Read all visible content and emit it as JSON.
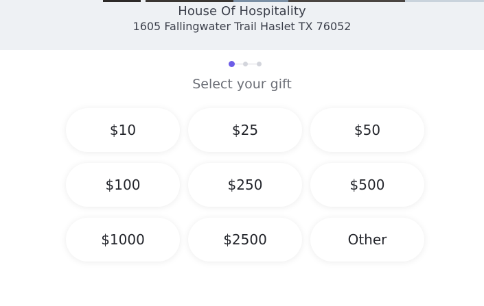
{
  "organization": {
    "name": "House Of Hospitality",
    "address": "1605 Fallingwater Trail Haslet TX 76052"
  },
  "stepper": {
    "total_steps": 3,
    "active_step": 1
  },
  "gift_selection": {
    "title": "Select your gift",
    "options": [
      "$10",
      "$25",
      "$50",
      "$100",
      "$250",
      "$500",
      "$1000",
      "$2500",
      "Other"
    ]
  },
  "colors": {
    "accent": "#6c5ce7",
    "header_bg": "#eef1f4",
    "text_dark": "#23252b",
    "text_muted": "#6b6e76"
  }
}
